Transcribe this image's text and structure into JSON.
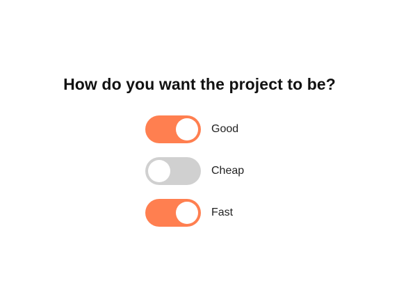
{
  "question": "How do you want the project to be?",
  "colors": {
    "accent": "#ff7f50",
    "off": "#d0d0d0"
  },
  "options": [
    {
      "label": "Good",
      "checked": true
    },
    {
      "label": "Cheap",
      "checked": false
    },
    {
      "label": "Fast",
      "checked": true
    }
  ]
}
